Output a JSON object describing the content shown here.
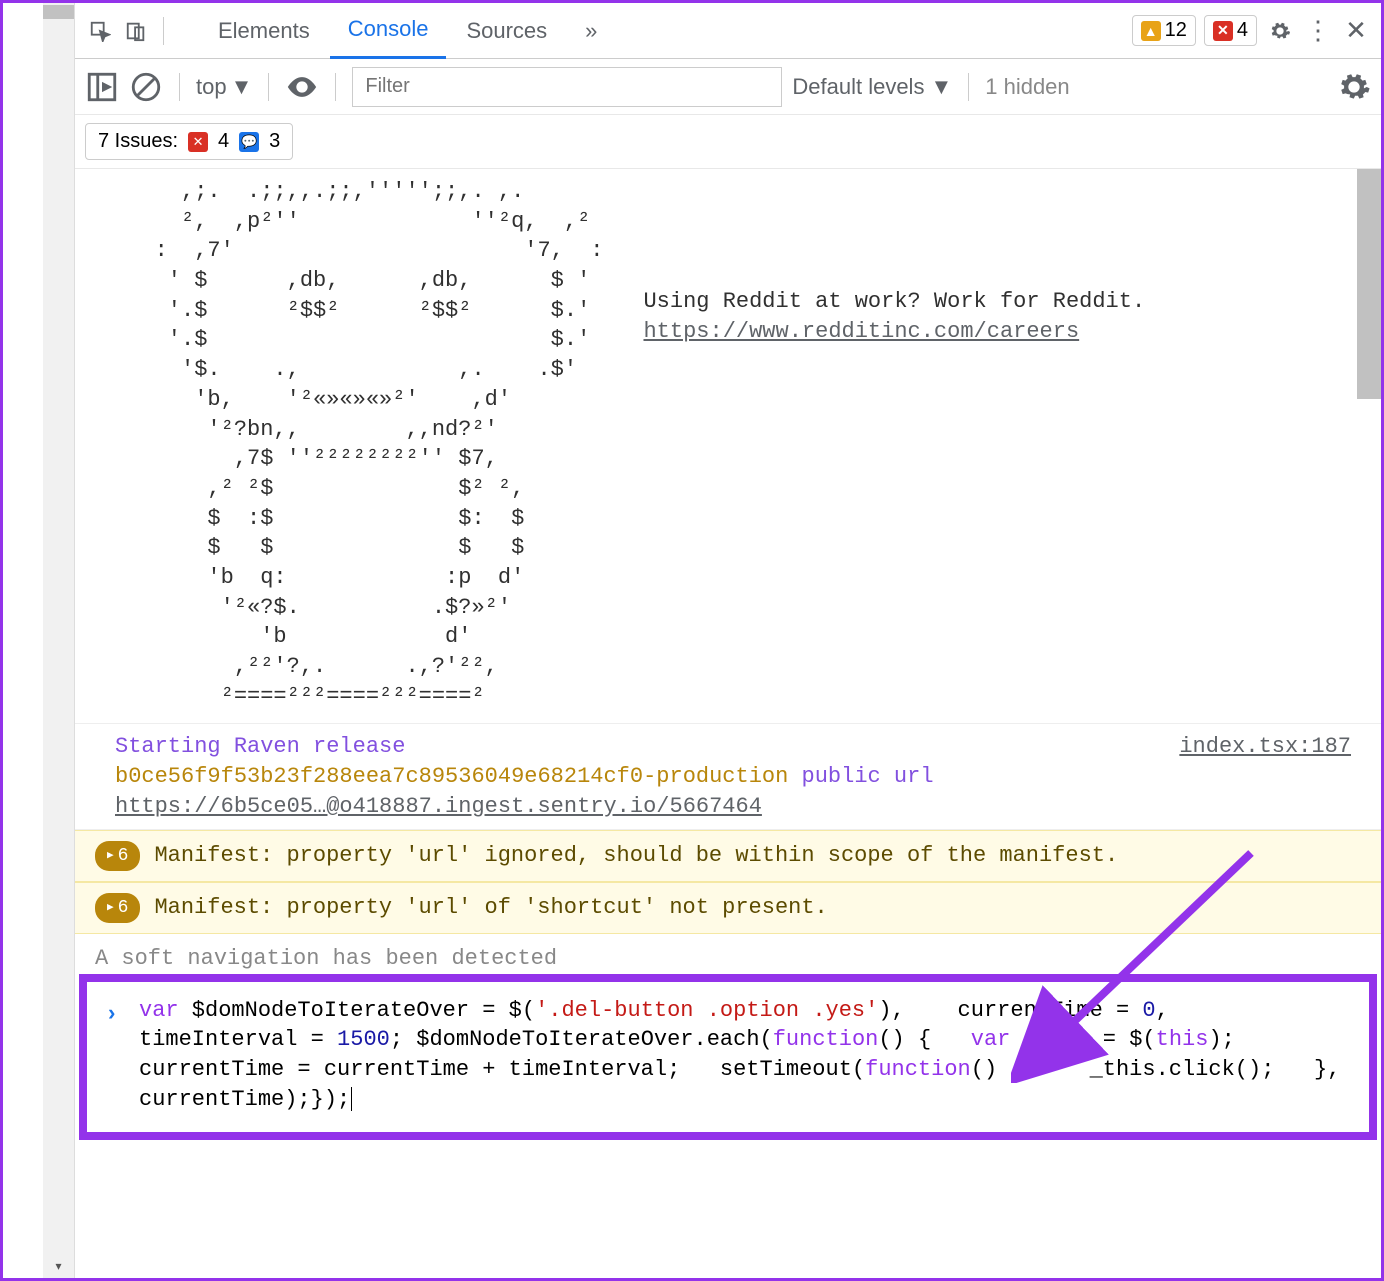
{
  "toolbar": {
    "tabs": [
      "Elements",
      "Console",
      "Sources"
    ],
    "active_tab": "Console",
    "more_tabs_glyph": "»",
    "warn_count": "12",
    "error_count": "4"
  },
  "subbar": {
    "context": "top",
    "filter_placeholder": "Filter",
    "levels_label": "Default levels",
    "hidden_label": "1 hidden"
  },
  "issues": {
    "label": "7 Issues:",
    "err_count": "4",
    "info_count": "3"
  },
  "ascii": {
    "art": "     ,;.  .;;,,.;;,''''';;,. ,.\n     ²,  ,p²''             ''²q,  ,²\n   :  ,7'                      '7,  :\n    ' $      ,db,      ,db,      $ '\n    '.$      ²$$²      ²$$²      $.'\n    '.$                          $.'\n     '$.    .,            ,.    .$'\n      'b,    '²«»«»«»²'    ,d'\n       '²?bn,,        ,,nd?²'\n         ,7$ ''²²²²²²²²'' $7,\n       ,² ²$              $² ²,\n       $  :$              $:  $\n       $   $              $   $\n       'b  q:            :p  d'\n        '²«?$.          .$?»²'\n           'b            d'\n         ,²²'?,.      .,?'²²,\n        ²====²²²====²²²====²",
    "side_text": "Using Reddit at work? Work for Reddit.",
    "side_link": "https://www.redditinc.com/careers"
  },
  "raven": {
    "text1": "Starting Raven release",
    "src": "index.tsx:187",
    "hash": "b0ce56f9f53b23f288eea7c89536049e68214cf0-production",
    "tail": "public url",
    "url": "https://6b5ce05…@o418887.ingest.sentry.io/5667464"
  },
  "warnings": [
    {
      "count": "6",
      "text": "Manifest: property 'url' ignored, should be within scope of the manifest."
    },
    {
      "count": "6",
      "text": "Manifest: property 'url' of 'shortcut' not present."
    }
  ],
  "truncated_text": "A soft navigation has been detected",
  "code": {
    "p1": "var",
    "p2": " $domNodeToIterateOver = $(",
    "str": "'.del-button .option .yes'",
    "p3": "),    currentTime = ",
    "n0": "0",
    "p4": ",    timeInterval = ",
    "n1": "1500",
    "p5": "; $domNodeToIterateOver.each(",
    "kw_fn1": "function",
    "p6": "() {   ",
    "kw_var2": "var",
    "p7": " _this = $(",
    "kw_this": "this",
    "p8": ");   currentTime = currentTime + timeInterval;   setTimeout(",
    "kw_fn2": "function",
    "p9": "() {     _this.click();   }, currentTime);});"
  }
}
